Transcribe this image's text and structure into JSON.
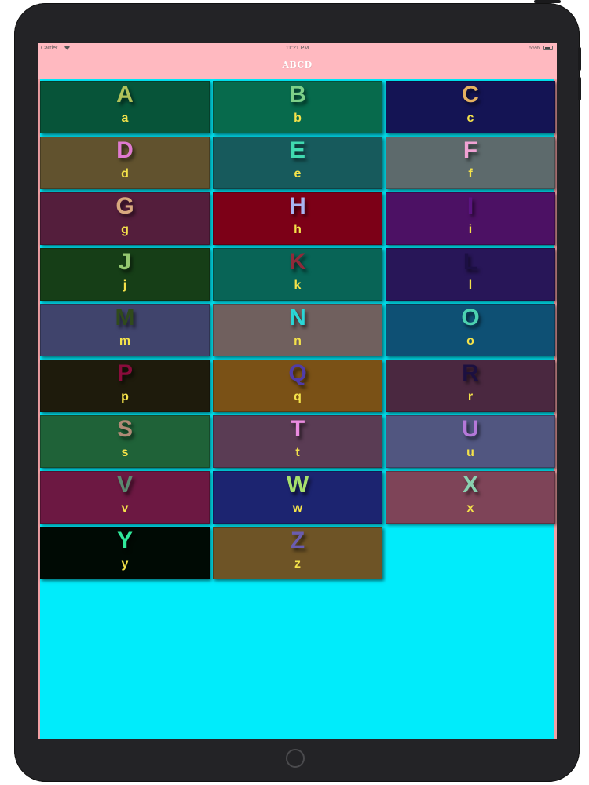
{
  "status_bar": {
    "carrier": "Carrier",
    "time": "11:21 PM",
    "battery": "66%"
  },
  "nav": {
    "title": "ABCD"
  },
  "tiles": [
    {
      "upper": "A",
      "lower": "a",
      "bg": "#075439",
      "fg": "#b0c25a"
    },
    {
      "upper": "B",
      "lower": "b",
      "bg": "#076a4c",
      "fg": "#7dcf88"
    },
    {
      "upper": "C",
      "lower": "c",
      "bg": "#141454",
      "fg": "#e4b060"
    },
    {
      "upper": "D",
      "lower": "d",
      "bg": "#61522e",
      "fg": "#e07ad0"
    },
    {
      "upper": "E",
      "lower": "e",
      "bg": "#175a5c",
      "fg": "#40d9b0"
    },
    {
      "upper": "F",
      "lower": "f",
      "bg": "#5d6a6c",
      "fg": "#f0a2d4"
    },
    {
      "upper": "G",
      "lower": "g",
      "bg": "#541e3c",
      "fg": "#d8a87e"
    },
    {
      "upper": "H",
      "lower": "h",
      "bg": "#7c0017",
      "fg": "#a8b4f0"
    },
    {
      "upper": "I",
      "lower": "i",
      "bg": "#4c1164",
      "fg": "#5a1480"
    },
    {
      "upper": "J",
      "lower": "j",
      "bg": "#163e17",
      "fg": "#94c870"
    },
    {
      "upper": "K",
      "lower": "k",
      "bg": "#086456",
      "fg": "#8e2a3a"
    },
    {
      "upper": "L",
      "lower": "l",
      "bg": "#281658",
      "fg": "#1c0f44"
    },
    {
      "upper": "M",
      "lower": "m",
      "bg": "#40446c",
      "fg": "#304a1c"
    },
    {
      "upper": "N",
      "lower": "n",
      "bg": "#70605e",
      "fg": "#2ad6d6"
    },
    {
      "upper": "O",
      "lower": "o",
      "bg": "#0e5074",
      "fg": "#4cd2b0"
    },
    {
      "upper": "P",
      "lower": "p",
      "bg": "#1e1b0c",
      "fg": "#8a0c3c"
    },
    {
      "upper": "Q",
      "lower": "q",
      "bg": "#7a5116",
      "fg": "#503ca8"
    },
    {
      "upper": "R",
      "lower": "r",
      "bg": "#4a2840",
      "fg": "#1c1040"
    },
    {
      "upper": "S",
      "lower": "s",
      "bg": "#1f6238",
      "fg": "#b08a76"
    },
    {
      "upper": "T",
      "lower": "t",
      "bg": "#5a3c54",
      "fg": "#ea8ce0"
    },
    {
      "upper": "U",
      "lower": "u",
      "bg": "#515680",
      "fg": "#b478d8"
    },
    {
      "upper": "V",
      "lower": "v",
      "bg": "#6c1842",
      "fg": "#5a8a70"
    },
    {
      "upper": "W",
      "lower": "w",
      "bg": "#1c2470",
      "fg": "#a6e06c"
    },
    {
      "upper": "X",
      "lower": "x",
      "bg": "#7e4458",
      "fg": "#8ad0b0"
    },
    {
      "upper": "Y",
      "lower": "y",
      "bg": "#000a04",
      "fg": "#30e89a"
    },
    {
      "upper": "Z",
      "lower": "z",
      "bg": "#6e5426",
      "fg": "#6a5cb0"
    }
  ]
}
